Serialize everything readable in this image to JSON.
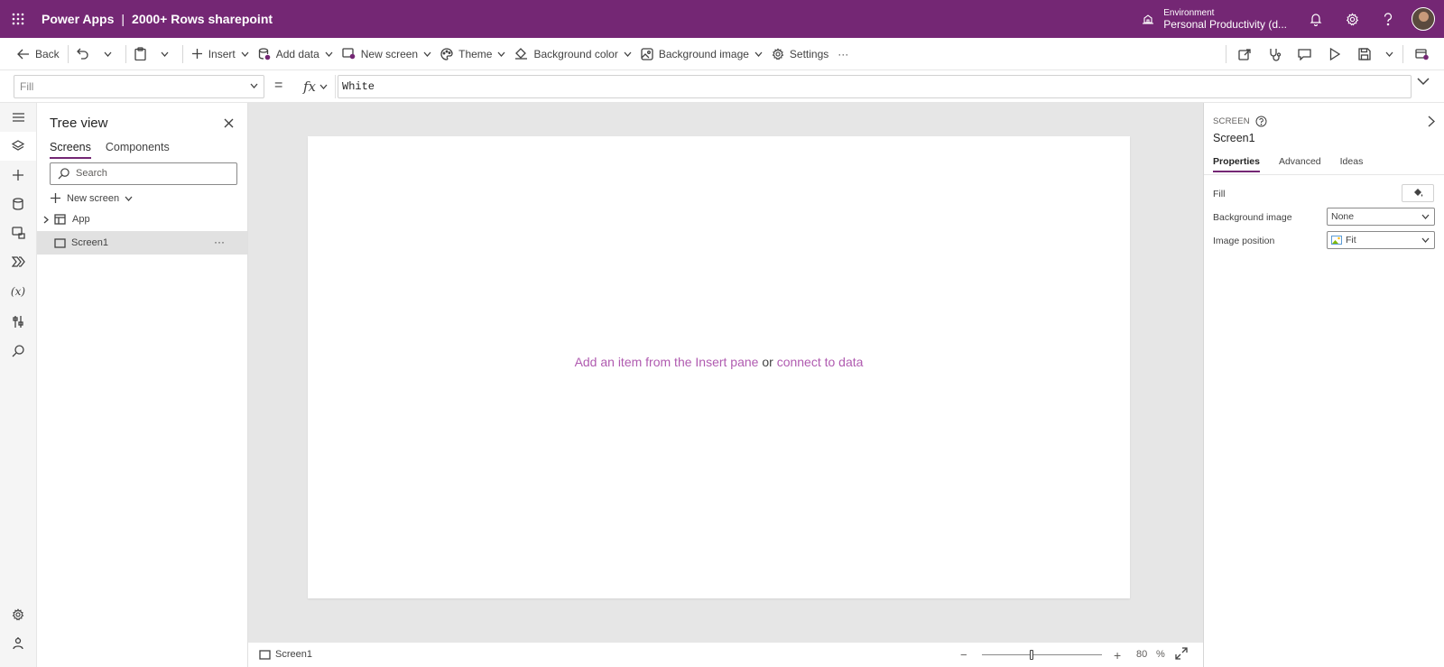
{
  "header": {
    "app_name": "Power Apps",
    "separator": "|",
    "project_name": "2000+ Rows sharepoint",
    "environment_label": "Environment",
    "environment_value": "Personal Productivity (d...",
    "brand_color": "#742774"
  },
  "commandbar": {
    "back": "Back",
    "insert": "Insert",
    "add_data": "Add data",
    "new_screen": "New screen",
    "theme": "Theme",
    "background_color": "Background color",
    "background_image": "Background image",
    "settings": "Settings",
    "more": "···"
  },
  "formula": {
    "property": "Fill",
    "equals": "=",
    "fx": "fx",
    "value": "White"
  },
  "tree": {
    "title": "Tree view",
    "tabs": [
      "Screens",
      "Components"
    ],
    "search_placeholder": "Search",
    "new_screen": "New screen",
    "items": [
      {
        "label": "App"
      },
      {
        "label": "Screen1"
      }
    ],
    "more": "···"
  },
  "canvas": {
    "hint_part1": "Add an item from the Insert pane",
    "hint_or": "or",
    "hint_part2": "connect to data"
  },
  "statusbar": {
    "screen": "Screen1",
    "zoom_value": "80",
    "zoom_unit": "%",
    "zoom_minus": "−",
    "zoom_plus": "+"
  },
  "properties": {
    "kind": "SCREEN",
    "name": "Screen1",
    "tabs": [
      "Properties",
      "Advanced",
      "Ideas"
    ],
    "fill_label": "Fill",
    "background_image_label": "Background image",
    "background_image_value": "None",
    "image_position_label": "Image position",
    "image_position_value": "Fit"
  }
}
